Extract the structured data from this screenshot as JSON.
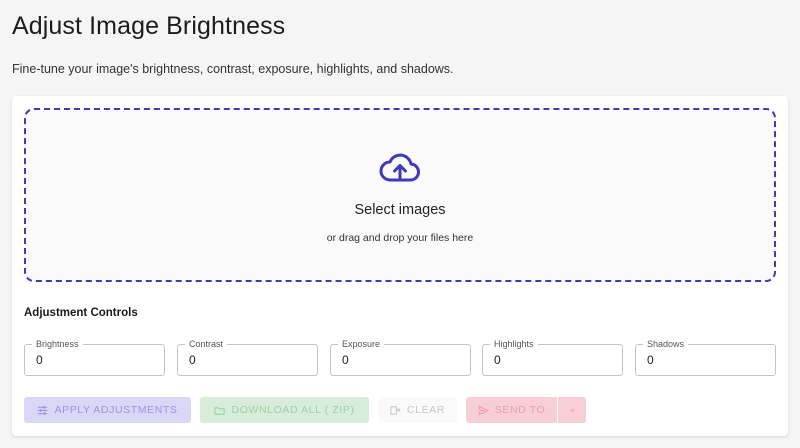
{
  "page": {
    "title": "Adjust Image Brightness",
    "subtitle": "Fine-tune your image's brightness, contrast, exposure, highlights, and shadows."
  },
  "dropzone": {
    "title": "Select images",
    "subtitle": "or drag and drop your files here",
    "icon": "cloud-upload-icon"
  },
  "controls": {
    "title": "Adjustment Controls",
    "fields": [
      {
        "label": "Brightness",
        "value": "0"
      },
      {
        "label": "Contrast",
        "value": "0"
      },
      {
        "label": "Exposure",
        "value": "0"
      },
      {
        "label": "Highlights",
        "value": "0"
      },
      {
        "label": "Shadows",
        "value": "0"
      }
    ]
  },
  "actions": {
    "apply_label": "APPLY ADJUSTMENTS",
    "download_label": "DOWNLOAD ALL ( ZIP)",
    "clear_label": "CLEAR",
    "send_label": "SEND TO"
  },
  "colors": {
    "accent": "#3f3ab8",
    "background": "#f5f5f5",
    "card": "#ffffff"
  }
}
